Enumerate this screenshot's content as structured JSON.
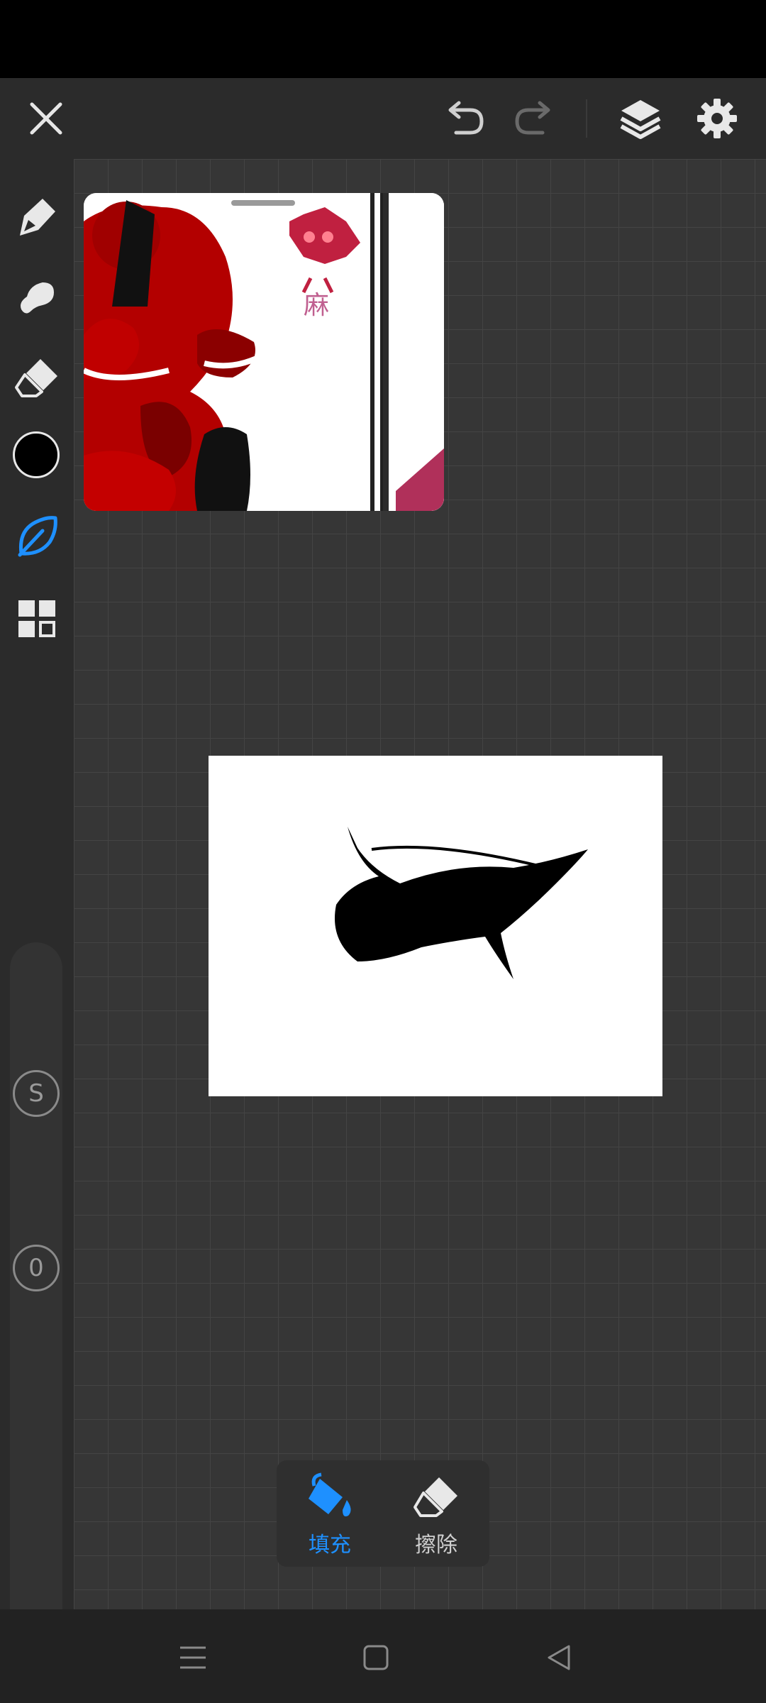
{
  "toolbar": {
    "close": "close",
    "undo": "undo",
    "redo": "redo",
    "layers": "layers",
    "settings": "settings"
  },
  "tools": [
    "pen-tool",
    "smudge-tool",
    "eraser-tool",
    "color-picker",
    "fill-tool",
    "grid-tool"
  ],
  "colors": {
    "active": "#1e90ff",
    "current_color": "#000000",
    "canvas_bg": "#363636",
    "panel_bg": "#2b2b2b"
  },
  "sliders": {
    "size_label": "S",
    "opacity_label": "0"
  },
  "fill_popup": {
    "fill_label": "填充",
    "erase_label": "擦除"
  }
}
